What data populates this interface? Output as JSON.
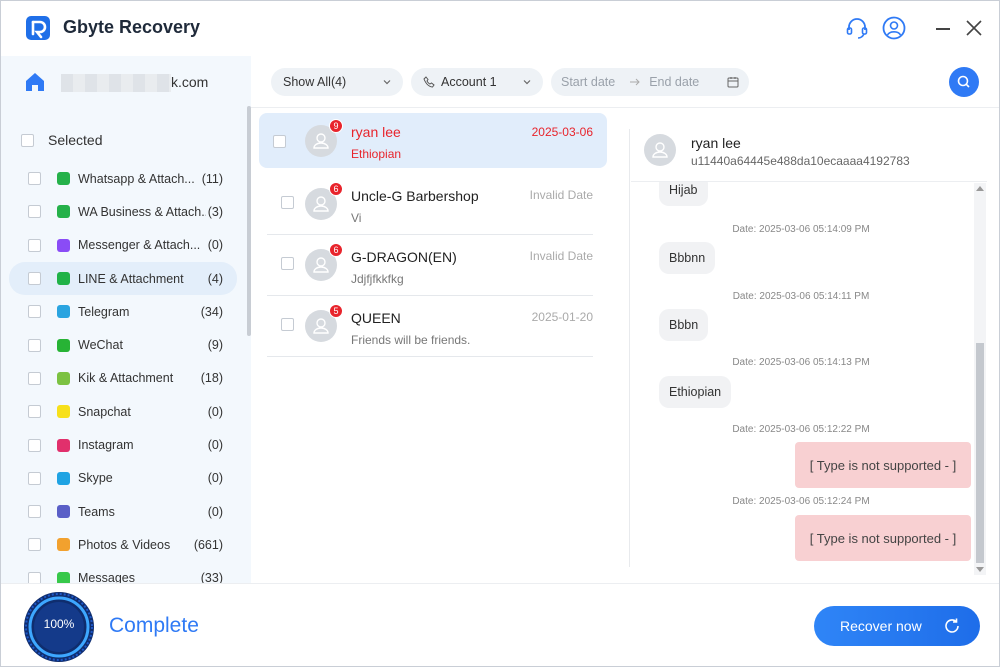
{
  "app": {
    "title": "Gbyte Recovery"
  },
  "account": {
    "email_suffix": "k.com"
  },
  "sidebar": {
    "selected_label": "Selected",
    "items": [
      {
        "label": "Whatsapp & Attach...",
        "count": "(11)",
        "icon": "whatsapp-icon",
        "color": "#25b14a"
      },
      {
        "label": "WA Business & Attach...",
        "count": "(3)",
        "icon": "wa-business-icon",
        "color": "#25b14a"
      },
      {
        "label": "Messenger & Attach...",
        "count": "(0)",
        "icon": "messenger-icon",
        "color": "#8a4cf6"
      },
      {
        "label": "LINE & Attachment",
        "count": "(4)",
        "icon": "line-icon",
        "color": "#20b247"
      },
      {
        "label": "Telegram",
        "count": "(34)",
        "icon": "telegram-icon",
        "color": "#2aa4e0"
      },
      {
        "label": "WeChat",
        "count": "(9)",
        "icon": "wechat-icon",
        "color": "#27b335"
      },
      {
        "label": "Kik & Attachment",
        "count": "(18)",
        "icon": "kik-icon",
        "color": "#7cc242"
      },
      {
        "label": "Snapchat",
        "count": "(0)",
        "icon": "snapchat-icon",
        "color": "#f7e01b"
      },
      {
        "label": "Instagram",
        "count": "(0)",
        "icon": "instagram-icon",
        "color": "#e1306c"
      },
      {
        "label": "Skype",
        "count": "(0)",
        "icon": "skype-icon",
        "color": "#1fa3e3"
      },
      {
        "label": "Teams",
        "count": "(0)",
        "icon": "teams-icon",
        "color": "#5a5fc7"
      },
      {
        "label": "Photos & Videos",
        "count": "(661)",
        "icon": "photos-icon",
        "color": "#f2a12e"
      },
      {
        "label": "Messages",
        "count": "(33)",
        "icon": "messages-icon",
        "color": "#37c84a"
      }
    ],
    "active_index": 3
  },
  "filters": {
    "show_all": "Show All(4)",
    "account": "Account 1",
    "start_placeholder": "Start date",
    "end_placeholder": "End date"
  },
  "chats": [
    {
      "name": "ryan lee",
      "message": "Ethiopian",
      "date": "2025-03-06",
      "badge": "9",
      "active": true
    },
    {
      "name": "Uncle-G Barbershop",
      "message": "Vi",
      "date": "Invalid Date",
      "badge": "6",
      "active": false
    },
    {
      "name": "G-DRAGON(EN)",
      "message": "Jdjfjfkkfkg",
      "date": "Invalid Date",
      "badge": "6",
      "active": false
    },
    {
      "name": "QUEEN",
      "message": "Friends will be friends.",
      "date": "2025-01-20",
      "badge": "5",
      "active": false
    }
  ],
  "conversation": {
    "name": "ryan lee",
    "id": "u11440a64445e488da10ecaaaa4192783",
    "messages": [
      {
        "type": "in",
        "text": "Hijab"
      },
      {
        "type": "date",
        "text": "Date: 2025-03-06 05:14:09 PM"
      },
      {
        "type": "in",
        "text": "Bbbnn"
      },
      {
        "type": "date",
        "text": "Date: 2025-03-06 05:14:11 PM"
      },
      {
        "type": "in",
        "text": "Bbbn"
      },
      {
        "type": "date",
        "text": "Date: 2025-03-06 05:14:13 PM"
      },
      {
        "type": "in",
        "text": "Ethiopian"
      },
      {
        "type": "date",
        "text": "Date: 2025-03-06 05:12:22 PM"
      },
      {
        "type": "out",
        "text": "[ Type is not supported - ]"
      },
      {
        "type": "date",
        "text": "Date: 2025-03-06 05:12:24 PM"
      },
      {
        "type": "out",
        "text": "[ Type is not supported - ]"
      }
    ]
  },
  "footer": {
    "progress": "100%",
    "status": "Complete",
    "recover_label": "Recover now"
  },
  "colors": {
    "accent": "#2f7af5",
    "alert": "#e8242c",
    "sidebar_bg": "#f3f8fd"
  }
}
